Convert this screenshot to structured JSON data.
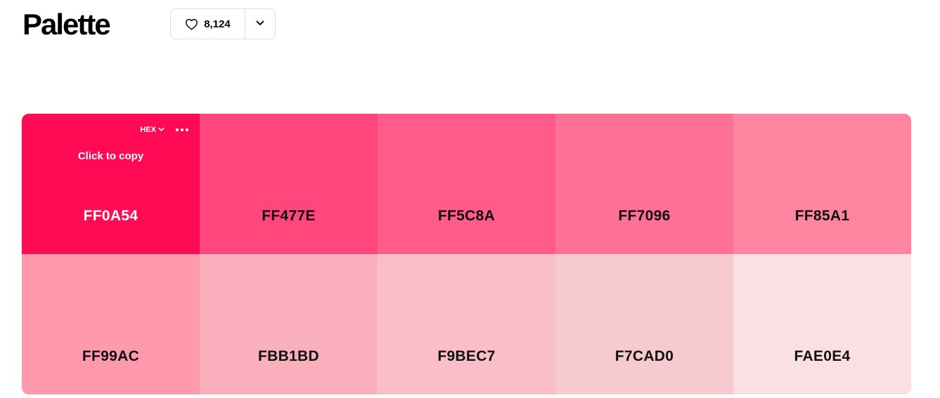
{
  "header": {
    "title": "Palette",
    "likes_count": "8,124"
  },
  "active_swatch": {
    "format_label": "HEX",
    "copy_hint": "Click to copy"
  },
  "swatches": [
    {
      "hex": "FF0A54",
      "color": "#FF0A54"
    },
    {
      "hex": "FF477E",
      "color": "#FF477E"
    },
    {
      "hex": "FF5C8A",
      "color": "#FF5C8A"
    },
    {
      "hex": "FF7096",
      "color": "#FF7096"
    },
    {
      "hex": "FF85A1",
      "color": "#FF85A1"
    },
    {
      "hex": "FF99AC",
      "color": "#FF99AC"
    },
    {
      "hex": "FBB1BD",
      "color": "#FBB1BD"
    },
    {
      "hex": "F9BEC7",
      "color": "#F9BEC7"
    },
    {
      "hex": "F7CAD0",
      "color": "#F7CAD0"
    },
    {
      "hex": "FAE0E4",
      "color": "#FAE0E4"
    }
  ],
  "icons": {
    "like": "heart-icon",
    "more": "chevron-down-icon",
    "format_dropdown": "chevron-down-icon",
    "options": "more-horizontal-icon"
  }
}
